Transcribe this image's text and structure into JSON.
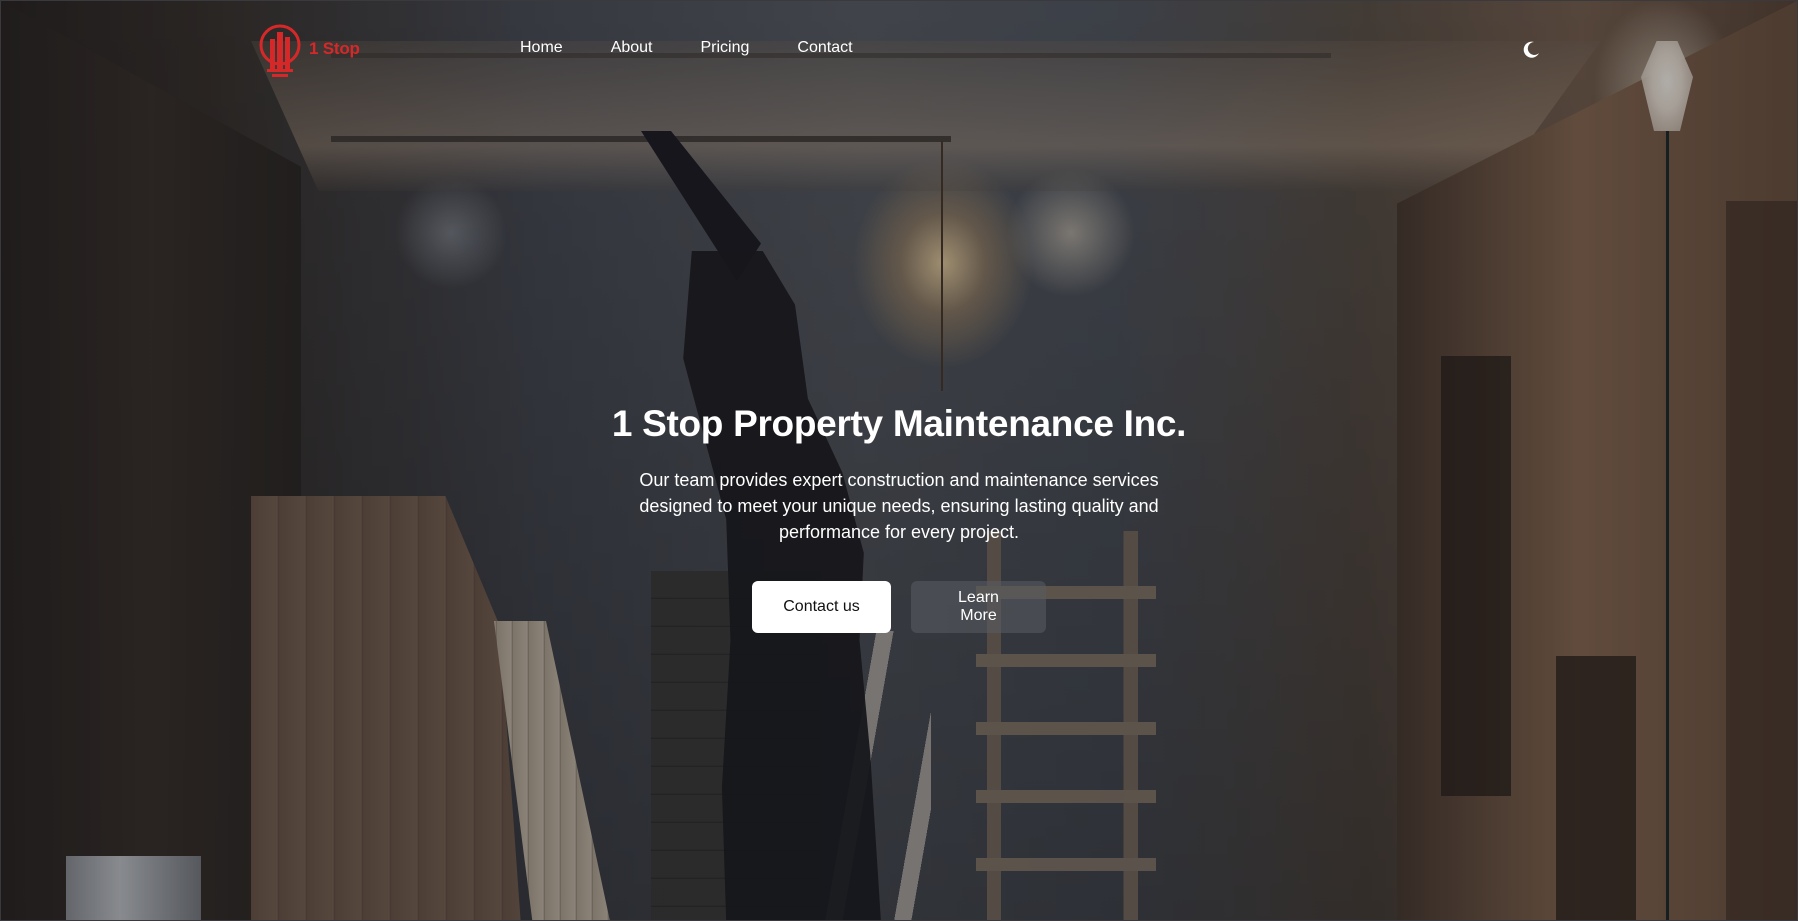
{
  "brand": {
    "logo_text": "1 Stop",
    "logo_color": "#d62828"
  },
  "nav": {
    "links": [
      {
        "label": "Home"
      },
      {
        "label": "About"
      },
      {
        "label": "Pricing"
      },
      {
        "label": "Contact"
      }
    ],
    "theme_toggle_icon": "moon-icon"
  },
  "hero": {
    "title": "1 Stop Property Maintenance Inc.",
    "subtitle": "Our team provides expert construction and maintenance services designed to meet your unique needs, ensuring lasting quality and performance for every project.",
    "primary_button": "Contact us",
    "secondary_button": "Learn More",
    "background_image": "construction-worker-photo"
  },
  "colors": {
    "accent": "#d62828",
    "text": "#ffffff",
    "primary_button_bg": "#ffffff"
  }
}
